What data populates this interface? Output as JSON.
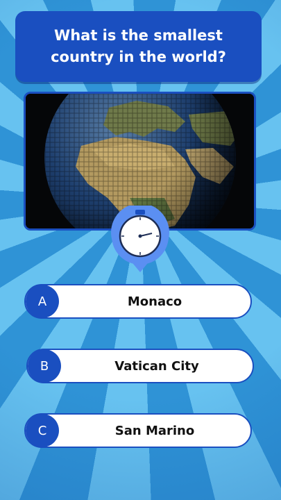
{
  "question": {
    "line1": "What is the smallest",
    "line2": "country in the world?"
  },
  "image": {
    "subject": "earth-globe-image"
  },
  "timer": {
    "icon": "stopwatch-icon"
  },
  "answers": [
    {
      "letter": "A",
      "text": "Monaco"
    },
    {
      "letter": "B",
      "text": "Vatican City"
    },
    {
      "letter": "C",
      "text": "San Marino"
    }
  ],
  "colors": {
    "accent": "#1a4fc0",
    "background_light": "#67c2f0",
    "background_dark": "#2f93d6",
    "timer_fill": "#5b8ff2"
  }
}
